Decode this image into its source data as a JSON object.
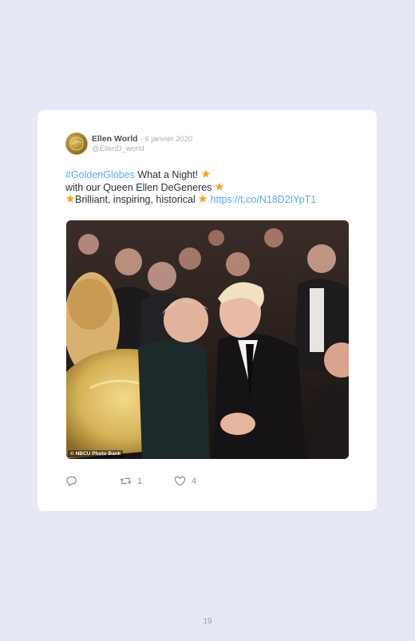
{
  "tweet": {
    "author_name": "Ellen World",
    "separator": "·",
    "date": "6 janvier 2020",
    "handle": "@EllenD_world",
    "hashtag": "#GoldenGlobes",
    "line1_text": " What a Night! ",
    "line2_text": "with our Queen Ellen DeGeneres ",
    "line3_text": "Brilliant, inspiring, historical ",
    "link": "https://t.co/N18D2IYpT1",
    "photo_credit": "© NBCU Photo Bank",
    "retweet_count": "1",
    "like_count": "4"
  },
  "icons": {
    "reply": "reply-icon",
    "retweet": "retweet-icon",
    "like": "heart-icon",
    "star": "star-emoji-icon"
  },
  "colors": {
    "background": "#e6e9f5",
    "link": "#55acee",
    "star": "#f4a623"
  },
  "page": {
    "number": "19"
  }
}
